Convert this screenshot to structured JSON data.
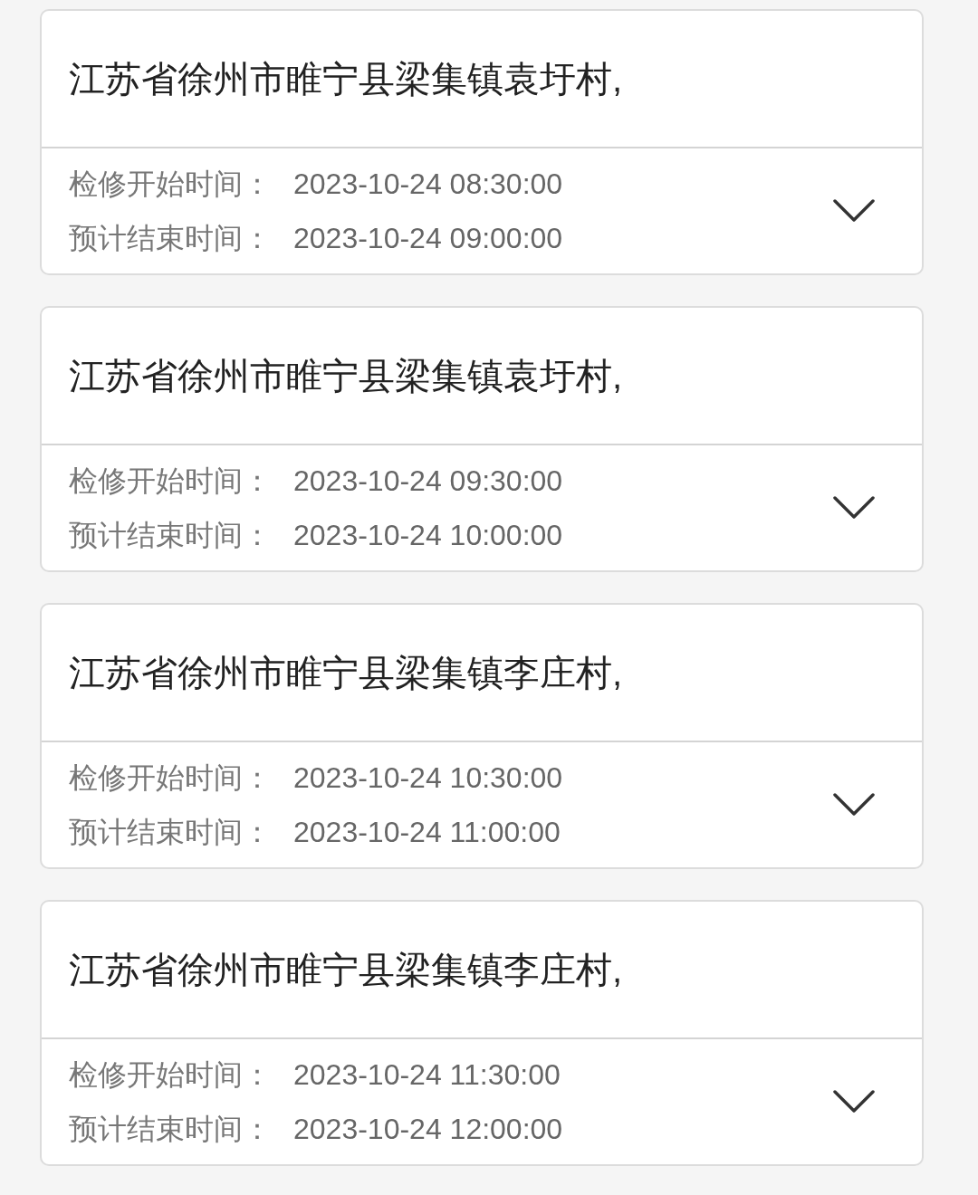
{
  "outages": [
    {
      "address": "江苏省徐州市睢宁县梁集镇袁圩村,",
      "start_label": "检修开始时间：",
      "start_time": "2023-10-24 08:30:00",
      "end_label": "预计结束时间：",
      "end_time": "2023-10-24 09:00:00",
      "expanded": false
    },
    {
      "address": "江苏省徐州市睢宁县梁集镇袁圩村,",
      "start_label": "检修开始时间：",
      "start_time": "2023-10-24 09:30:00",
      "end_label": "预计结束时间：",
      "end_time": "2023-10-24 10:00:00",
      "expanded": false
    },
    {
      "address": "江苏省徐州市睢宁县梁集镇李庄村,",
      "start_label": "检修开始时间：",
      "start_time": "2023-10-24 10:30:00",
      "end_label": "预计结束时间：",
      "end_time": "2023-10-24 11:00:00",
      "expanded": false
    },
    {
      "address": "江苏省徐州市睢宁县梁集镇李庄村,",
      "start_label": "检修开始时间：",
      "start_time": "2023-10-24 11:30:00",
      "end_label": "预计结束时间：",
      "end_time": "2023-10-24 12:00:00",
      "expanded": false
    }
  ]
}
